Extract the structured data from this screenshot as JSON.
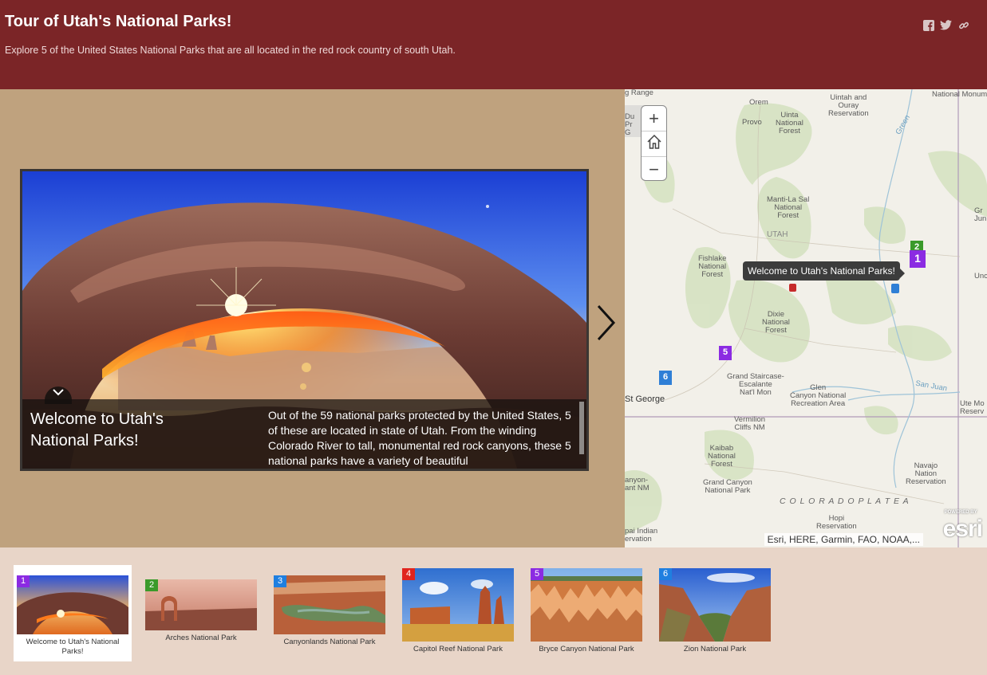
{
  "header": {
    "title": "Tour of Utah's National Parks!",
    "subtitle": "Explore 5 of the United States National Parks that are all located in the red rock country of south Utah.",
    "background": "#7b2527",
    "share_icons": [
      "facebook-icon",
      "twitter-icon",
      "link-icon"
    ]
  },
  "story": {
    "background": "#bfa27e",
    "caption_title": "Welcome to Utah's National Parks!",
    "caption_text": "Out of the 59 national parks protected by the United States, 5 of these are located in state of Utah. From the winding Colorado River to tall, monumental red rock canyons, these 5 national parks have a variety of beautiful",
    "next_icon": "chevron-right-icon",
    "toggle_icon": "chevron-down-icon"
  },
  "map": {
    "zoom_in": "+",
    "zoom_out": "−",
    "home_icon": "home-icon",
    "tooltip": "Welcome to Utah's National Parks!",
    "attribution": "Esri, HERE, Garmin, FAO, NOAA,...",
    "logo_small": "POWERED BY",
    "logo": "esri",
    "labels": {
      "orem": "Orem",
      "provo": "Provo",
      "uintah_ouray": "Uintah and\nOuray\nReservation",
      "uinta_nf": "Uinta\nNational\nForest",
      "range": "g Range",
      "national_monu": "National Monum",
      "green": "Green",
      "manti": "Manti-La Sal\nNational\nForest",
      "utah": "UTAH",
      "fishlake": "Fishlake\nNational\nForest",
      "dixie": "Dixie\nNational\nForest",
      "st_george": "St George",
      "grand_staircase": "Grand Staircase-\nEscalante\nNat'l Mon",
      "glen_canyon": "Glen\nCanyon National\nRecreation Area",
      "san_juan": "San Juan",
      "ute_mount": "Ute Mo\nReserv",
      "vermilion": "Vermilion\nCliffs NM",
      "kaibab": "Kaibab\nNational\nForest",
      "grand_canyon_np": "Grand Canyon\nNational Park",
      "navajo": "Navajo\nNation\nReservation",
      "colorado_plateau": "C O L O R A D O   P L A T E A",
      "hopi": "Hopi\nReservation",
      "canyon_nm": "anyon-\nant NM",
      "pai_indian": "pai Indian\nervation",
      "gr_jun": "Gr\nJun",
      "unc": "Unc",
      "du_pr": "Du\nPr\nG"
    },
    "markers": [
      {
        "n": "1",
        "color": "#8b2be2"
      },
      {
        "n": "2",
        "color": "#3a9a2a"
      },
      {
        "n": "5",
        "color": "#8b2be2"
      },
      {
        "n": "6",
        "color": "#2f7fd6"
      }
    ]
  },
  "carousel": [
    {
      "n": "1",
      "label": "Welcome to Utah's National Parks!",
      "color": "#8b2be2"
    },
    {
      "n": "2",
      "label": "Arches National Park",
      "color": "#3a9a2a"
    },
    {
      "n": "3",
      "label": "Canyonlands National Park",
      "color": "#1f7fe0"
    },
    {
      "n": "4",
      "label": "Capitol Reef National Park",
      "color": "#e0241e"
    },
    {
      "n": "5",
      "label": "Bryce Canyon National Park",
      "color": "#8b2be2"
    },
    {
      "n": "6",
      "label": "Zion National Park",
      "color": "#1f7fe0"
    }
  ]
}
